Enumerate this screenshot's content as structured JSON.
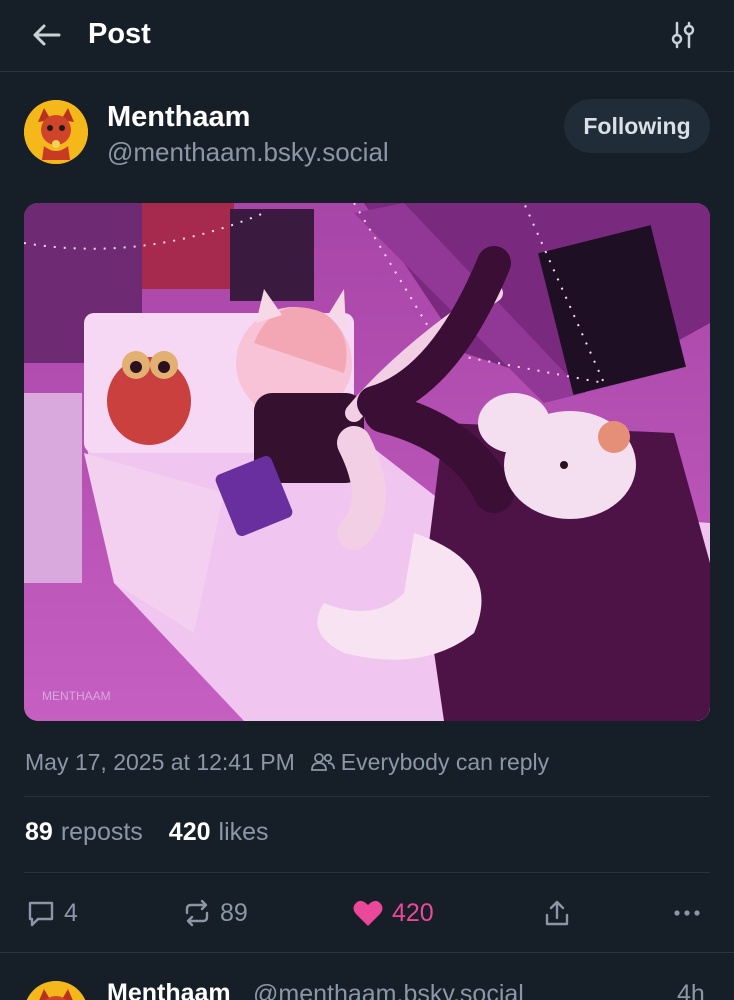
{
  "header": {
    "title": "Post"
  },
  "author": {
    "display_name": "Menthaam",
    "handle": "@menthaam.bsky.social",
    "follow_label": "Following"
  },
  "image": {
    "watermark": "MENTHAAM"
  },
  "post": {
    "timestamp": "May 17, 2025 at 12:41 PM",
    "reply_setting": "Everybody can reply"
  },
  "stats": {
    "reposts_count": "89",
    "reposts_label": "reposts",
    "likes_count": "420",
    "likes_label": "likes"
  },
  "actions": {
    "reply_count": "4",
    "repost_count": "89",
    "like_count": "420"
  },
  "reply": {
    "display_name": "Menthaam",
    "handle": "@menthaam.bsky.social",
    "time": "4h"
  },
  "colors": {
    "background": "#161e27",
    "accent_like": "#ec4899",
    "muted_text": "#8b97a6",
    "avatar_bg": "#f5b81a"
  },
  "icons": [
    "back-arrow-icon",
    "filter-sliders-icon",
    "people-icon",
    "reply-icon",
    "repost-icon",
    "heart-icon",
    "share-icon",
    "more-icon"
  ]
}
